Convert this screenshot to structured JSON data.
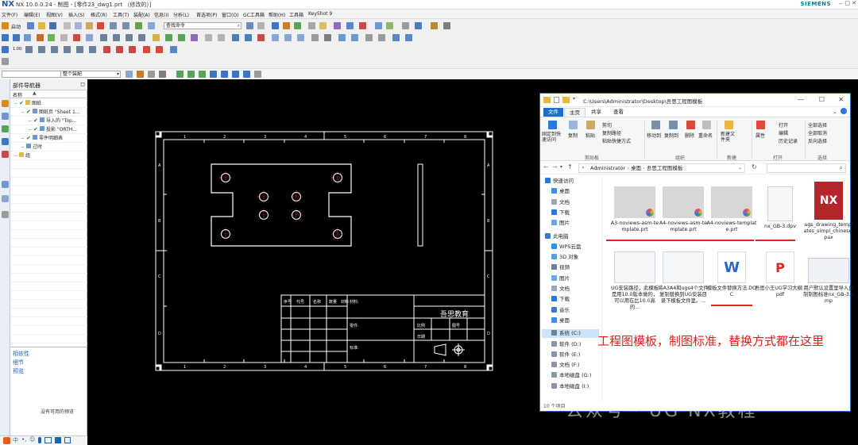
{
  "nx": {
    "title": "NX 10.0.0.24 - 制图 - [零件23_dwg1.prt （修改的）]",
    "brand": "SIEMENS",
    "menus": [
      "文件(F)",
      "编辑(E)",
      "视图(V)",
      "插入(S)",
      "格式(R)",
      "工具(T)",
      "装配(A)",
      "信息(I)",
      "分析(L)",
      "首选项(P)",
      "窗口(O)",
      "GC工具箱",
      "帮助(H)",
      "工具箱",
      "KeyShot 9"
    ],
    "toolbar": {
      "start_label": "启动",
      "command_search_placeholder": "查找命令",
      "selection_filter": "",
      "selection_scope": "整个装配"
    },
    "colors": {
      "accent": "#1f6fc8",
      "red": "#e0241b",
      "check": "#1d8a1d",
      "drawing_line": "#ffffff",
      "hole_center": "#ff3030"
    }
  },
  "navigator": {
    "title": "部件导航器",
    "column_name": "名称",
    "tree": [
      {
        "label": "图纸",
        "indent": 0,
        "checked": true
      },
      {
        "label": "图纸页 \"Sheet 1...",
        "indent": 1,
        "checked": true
      },
      {
        "label": "导入的 \"Top...",
        "indent": 2,
        "checked": true
      },
      {
        "label": "投影 \"ORTH...",
        "indent": 2,
        "checked": true
      },
      {
        "label": "零件明细表",
        "indent": 1,
        "checked": true
      },
      {
        "label": "过时",
        "indent": 1,
        "checked": false
      },
      {
        "label": "组",
        "indent": 0,
        "checked": false
      }
    ],
    "panels": [
      "相依性",
      "细节",
      "预览"
    ],
    "no_preview": "没有可用的预览"
  },
  "drawing": {
    "company": "吾思教育",
    "title_block_labels": [
      "材料:",
      "零件:",
      "比例",
      "图号",
      "标准:",
      "日期"
    ],
    "revision_headers": [
      "序号",
      "代号",
      "名称",
      "数量",
      "材料",
      "备注"
    ],
    "border_letters": [
      "A",
      "B",
      "C",
      "D"
    ],
    "border_numbers": [
      "1",
      "2",
      "3",
      "4",
      "5",
      "6",
      "7",
      "8"
    ]
  },
  "explorer": {
    "path": "C:\\Users\\Administrator\\Desktop\\吾思工程图模板",
    "tabs": [
      "文件",
      "主页",
      "共享",
      "查看"
    ],
    "ribbon": {
      "groups": [
        "剪贴板",
        "组织",
        "新建",
        "打开",
        "选择"
      ],
      "items": {
        "pin": "固定到快速访问",
        "copy": "复制",
        "paste": "粘贴",
        "cut": "剪切",
        "copy_path": "复制路径",
        "paste_shortcut": "粘贴快捷方式",
        "move_to": "移动到",
        "copy_to": "复制到",
        "delete": "删除",
        "rename": "重命名",
        "new_folder": "新建文件夹",
        "properties": "属性",
        "open": "打开",
        "edit": "编辑",
        "history": "历史记录",
        "select_all": "全部选择",
        "select_none": "全部取消",
        "invert": "反向选择"
      }
    },
    "breadcrumb": [
      "Administrator",
      "桌面",
      "吾思工程图模板"
    ],
    "nav": [
      {
        "label": "快速访问",
        "icon": "star-icon",
        "color": "#2b78d6",
        "indent": 0
      },
      {
        "label": "桌面",
        "icon": "desktop-icon",
        "color": "#3f8fe0",
        "indent": 1
      },
      {
        "label": "文档",
        "icon": "documents-icon",
        "color": "#9aa5b5",
        "indent": 1
      },
      {
        "label": "下载",
        "icon": "download-icon",
        "color": "#2b78d6",
        "indent": 1
      },
      {
        "label": "图片",
        "icon": "pictures-icon",
        "color": "#6aa7e8",
        "indent": 1
      },
      {
        "label": "此电脑",
        "icon": "computer-icon",
        "color": "#3a78c8",
        "indent": 0
      },
      {
        "label": "WPS云盘",
        "icon": "cloud-icon",
        "color": "#2f8df0",
        "indent": 1
      },
      {
        "label": "3D 对象",
        "icon": "cube-icon",
        "color": "#5a9ee6",
        "indent": 1
      },
      {
        "label": "视频",
        "icon": "video-icon",
        "color": "#6a7d9a",
        "indent": 1
      },
      {
        "label": "图片",
        "icon": "pictures-icon",
        "color": "#6aa7e8",
        "indent": 1
      },
      {
        "label": "文档",
        "icon": "documents-icon",
        "color": "#9aa5b5",
        "indent": 1
      },
      {
        "label": "下载",
        "icon": "download-icon",
        "color": "#2b78d6",
        "indent": 1
      },
      {
        "label": "音乐",
        "icon": "music-icon",
        "color": "#3a78c8",
        "indent": 1
      },
      {
        "label": "桌面",
        "icon": "desktop-icon",
        "color": "#3f8fe0",
        "indent": 1
      },
      {
        "label": "系统 (C:)",
        "icon": "drive-icon",
        "color": "#6f7f92",
        "indent": 1
      },
      {
        "label": "软件 (D:)",
        "icon": "drive-icon",
        "color": "#8a96a6",
        "indent": 1
      },
      {
        "label": "软件 (E:)",
        "icon": "drive-icon",
        "color": "#8a96a6",
        "indent": 1
      },
      {
        "label": "文档 (F:)",
        "icon": "drive-icon",
        "color": "#8a96a6",
        "indent": 1
      },
      {
        "label": "本地磁盘 (G:)",
        "icon": "drive-icon",
        "color": "#8a96a6",
        "indent": 1
      },
      {
        "label": "本地磁盘 (I:)",
        "icon": "drive-icon",
        "color": "#8a96a6",
        "indent": 1
      }
    ],
    "files": [
      {
        "name": "A3-noviews-asm-template.prt",
        "kind": "prt"
      },
      {
        "name": "A4-noviews-asm-template.prt",
        "kind": "prt"
      },
      {
        "name": "A4-noviews-template.prt",
        "kind": "prt"
      },
      {
        "name": "nx_GB-3.dpv",
        "kind": "blank"
      },
      {
        "name": "ugs_drawing_templates_simpl_chinese.pax",
        "kind": "nx"
      },
      {
        "name": "UG安装路径，此模板是用10.0版本做的，可以用在比10.0高的...",
        "kind": "doc-thumb"
      },
      {
        "name": "将A3A4和ugs4个文件复制替换到UG安装目录下模板文件里。...",
        "kind": "doc-thumb"
      },
      {
        "name": "模板文件替换方法.DOC",
        "kind": "word"
      },
      {
        "name": "吾思小王UG学习大纲 .pdf",
        "kind": "pdf"
      },
      {
        "name": "用户默认设置里导入自制制图标准nx_GB-3.bmp",
        "kind": "bmp"
      }
    ],
    "status": "10 个项目"
  },
  "overlay": {
    "caption": "工程图模板，制图标准，替换方式都在这里",
    "watermark": "公众号 · UG NX教程"
  }
}
